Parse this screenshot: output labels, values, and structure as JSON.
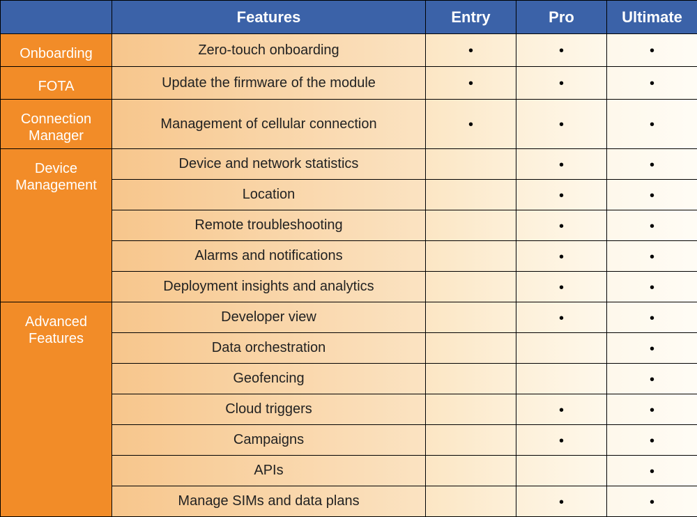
{
  "headers": {
    "blank": "",
    "features": "Features",
    "entry": "Entry",
    "pro": "Pro",
    "ultimate": "Ultimate"
  },
  "bullet": "•",
  "categories": [
    {
      "name": "Onboarding",
      "rows": [
        {
          "feature": "Zero-touch onboarding",
          "entry": true,
          "pro": true,
          "ultimate": true
        }
      ]
    },
    {
      "name": "FOTA",
      "rows": [
        {
          "feature": "Update the firmware of the module",
          "entry": true,
          "pro": true,
          "ultimate": true
        }
      ]
    },
    {
      "name": "Connection Manager",
      "rows": [
        {
          "feature": "Management of cellular connection",
          "entry": true,
          "pro": true,
          "ultimate": true
        }
      ]
    },
    {
      "name": "Device Management",
      "rows": [
        {
          "feature": "Device and network statistics",
          "entry": false,
          "pro": true,
          "ultimate": true
        },
        {
          "feature": "Location",
          "entry": false,
          "pro": true,
          "ultimate": true
        },
        {
          "feature": "Remote troubleshooting",
          "entry": false,
          "pro": true,
          "ultimate": true
        },
        {
          "feature": "Alarms and notifications",
          "entry": false,
          "pro": true,
          "ultimate": true
        },
        {
          "feature": "Deployment insights and analytics",
          "entry": false,
          "pro": true,
          "ultimate": true
        }
      ]
    },
    {
      "name": "Advanced Features",
      "rows": [
        {
          "feature": "Developer view",
          "entry": false,
          "pro": true,
          "ultimate": true
        },
        {
          "feature": "Data orchestration",
          "entry": false,
          "pro": false,
          "ultimate": true
        },
        {
          "feature": "Geofencing",
          "entry": false,
          "pro": false,
          "ultimate": true
        },
        {
          "feature": "Cloud triggers",
          "entry": false,
          "pro": true,
          "ultimate": true
        },
        {
          "feature": "Campaigns",
          "entry": false,
          "pro": true,
          "ultimate": true
        },
        {
          "feature": "APIs",
          "entry": false,
          "pro": false,
          "ultimate": true
        },
        {
          "feature": "Manage SIMs and data plans",
          "entry": false,
          "pro": true,
          "ultimate": true
        }
      ]
    }
  ]
}
